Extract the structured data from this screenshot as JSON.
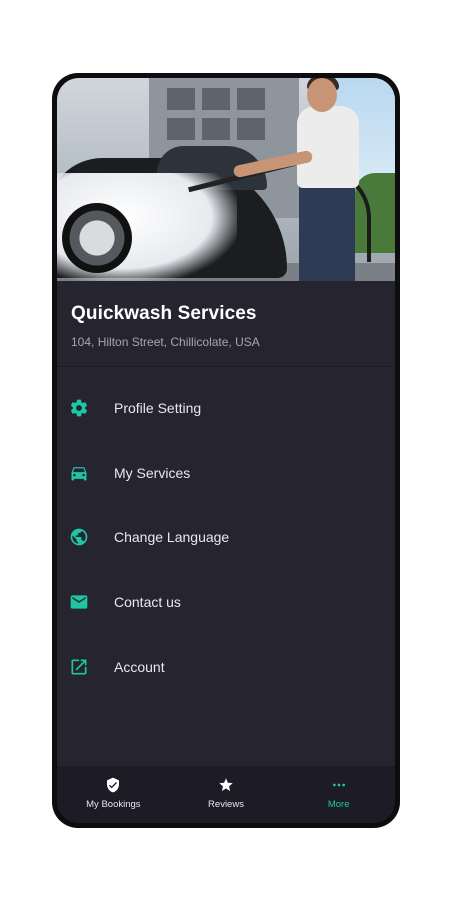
{
  "colors": {
    "accent": "#1fc6a4",
    "background": "#25242f",
    "bottom_nav": "#1d1c26",
    "text_primary": "#ffffff",
    "text_secondary": "#a6a6b2"
  },
  "business": {
    "name": "Quickwash Services",
    "address": "104, Hilton Street, Chillicolate, USA"
  },
  "menu": {
    "items": [
      {
        "label": "Profile Setting",
        "icon": "gear-icon"
      },
      {
        "label": "My Services",
        "icon": "car-icon"
      },
      {
        "label": "Change Language",
        "icon": "globe-icon"
      },
      {
        "label": "Contact us",
        "icon": "mail-icon"
      },
      {
        "label": "Account",
        "icon": "external-link-icon"
      }
    ]
  },
  "bottom_nav": {
    "items": [
      {
        "label": "My Bookings",
        "icon": "shield-check-icon",
        "active": false
      },
      {
        "label": "Reviews",
        "icon": "star-icon",
        "active": false
      },
      {
        "label": "More",
        "icon": "more-dots-icon",
        "active": true
      }
    ]
  }
}
